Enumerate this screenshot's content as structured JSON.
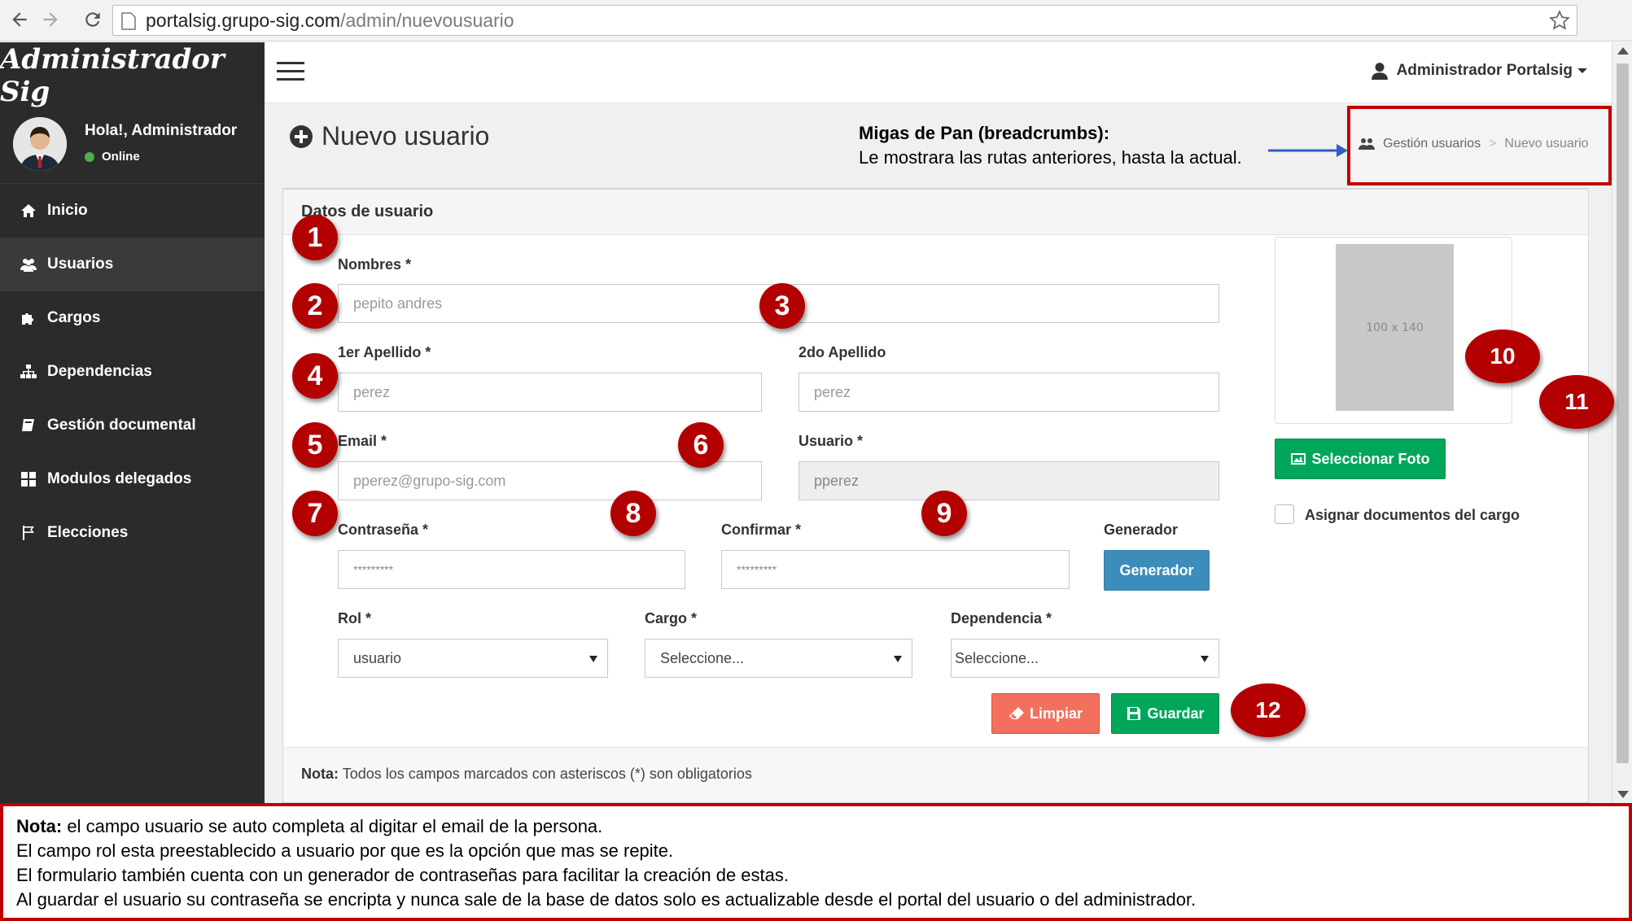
{
  "browser": {
    "url_host": "portalsig.grupo-sig.com",
    "url_path": "/admin/nuevousuario"
  },
  "sidebar": {
    "brand": "Administrador Sig",
    "user_greeting": "Hola!, Administrador",
    "user_status": "Online",
    "items": [
      {
        "label": "Inicio",
        "icon": "home-icon"
      },
      {
        "label": "Usuarios",
        "icon": "users-icon"
      },
      {
        "label": "Cargos",
        "icon": "puzzle-icon"
      },
      {
        "label": "Dependencias",
        "icon": "sitemap-icon"
      },
      {
        "label": "Gestión documental",
        "icon": "book-icon"
      },
      {
        "label": "Modulos delegados",
        "icon": "grid-icon"
      },
      {
        "label": "Elecciones",
        "icon": "flag-icon"
      }
    ]
  },
  "header": {
    "user_menu": "Administrador Portalsig"
  },
  "page": {
    "title": "Nuevo usuario",
    "callout_title": "Migas de Pan (breadcrumbs):",
    "callout_text": "Le mostrara las rutas anteriores, hasta la actual.",
    "breadcrumb": [
      "Gestión usuarios",
      "Nuevo usuario"
    ]
  },
  "form": {
    "box_title": "Datos de usuario",
    "nombres_label": "Nombres *",
    "nombres_placeholder": "pepito andres",
    "apellido1_label": "1er Apellido *",
    "apellido1_placeholder": "perez",
    "apellido2_label": "2do Apellido",
    "apellido2_placeholder": "perez",
    "email_label": "Email *",
    "email_placeholder": "pperez@grupo-sig.com",
    "usuario_label": "Usuario *",
    "usuario_value": "pperez",
    "password_label": "Contraseña *",
    "password_value": "*********",
    "confirm_label": "Confirmar *",
    "confirm_value": "*********",
    "generator_label": "Generador",
    "generator_button": "Generador",
    "rol_label": "Rol *",
    "rol_value": "usuario",
    "cargo_label": "Cargo *",
    "cargo_value": "Seleccione...",
    "dependencia_label": "Dependencia *",
    "dependencia_value": "Seleccione...",
    "clear_button": "Limpiar",
    "save_button": "Guardar",
    "photo_placeholder": "100 x 140",
    "photo_button": "Seleccionar Foto",
    "assign_docs_label": "Asignar documentos del cargo",
    "footer_note_bold": "Nota:",
    "footer_note": "Todos los campos marcados con asteriscos (*) son obligatorios"
  },
  "badges": [
    "1",
    "2",
    "3",
    "4",
    "5",
    "6",
    "7",
    "8",
    "9",
    "10",
    "11",
    "12"
  ],
  "note": {
    "bold": "Nota:",
    "line1": "el campo usuario se auto completa al digitar el email de la persona.",
    "line2": "El campo rol esta preestablecido a usuario por que es la opción que mas se repite.",
    "line3": "El formulario también cuenta con un generador de contraseñas para facilitar la creación de estas.",
    "line4": "Al guardar el usuario su contraseña se encripta y nunca sale de la base de datos solo es actualizable desde el portal del usuario o del administrador."
  },
  "colors": {
    "sidebar_bg": "#2b2b2b",
    "accent_blue": "#3c8dbc",
    "success_green": "#00a65a",
    "danger_red": "#f3705e",
    "badge_red": "#b30000",
    "annotation_border": "#c00000"
  }
}
